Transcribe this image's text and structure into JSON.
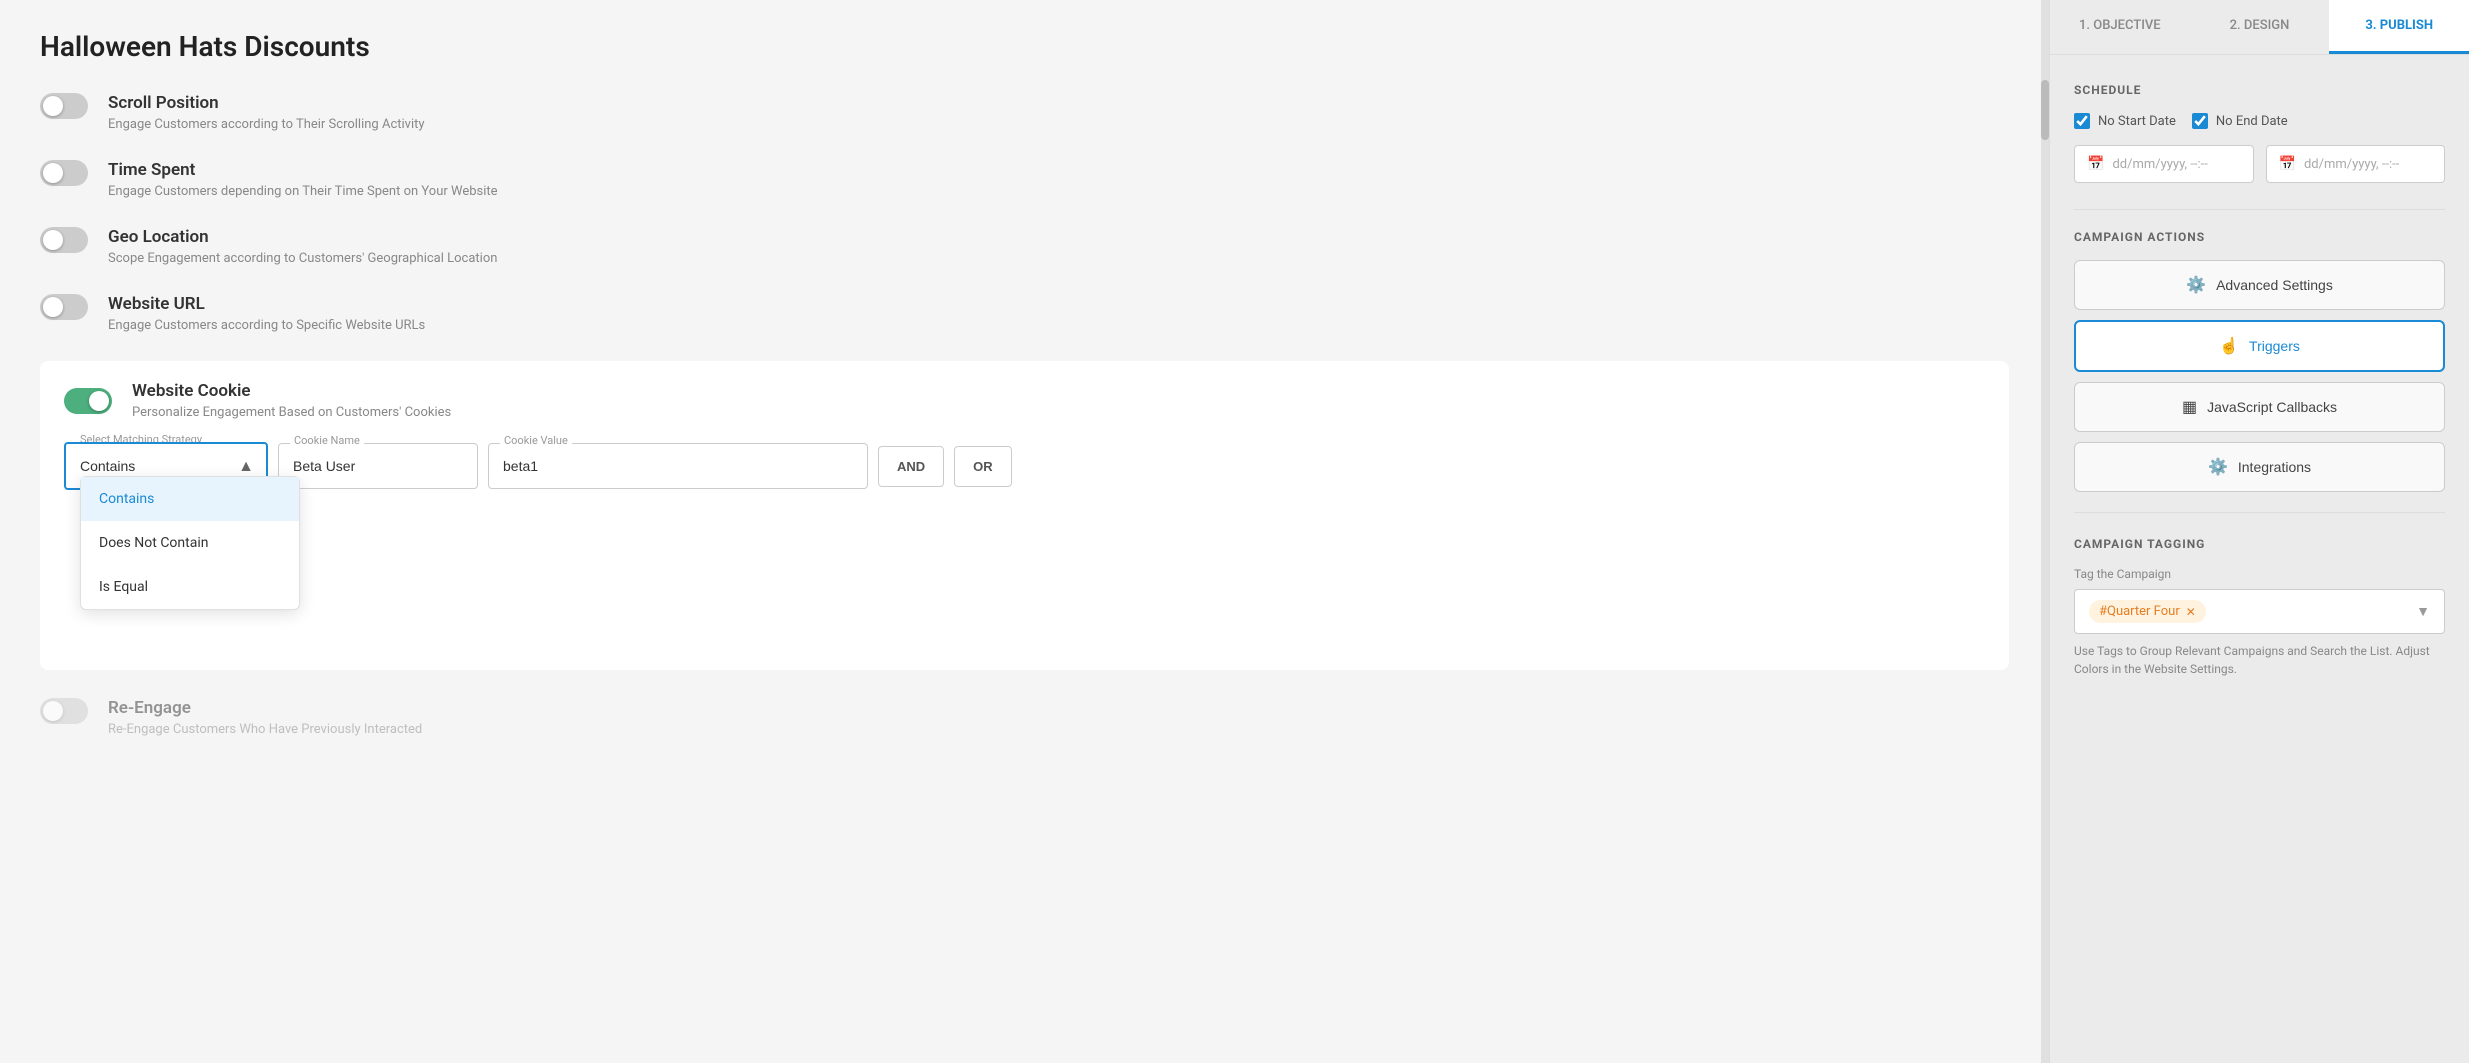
{
  "app": {
    "title": "Halloween Hats Discounts"
  },
  "tabs": [
    {
      "id": "objective",
      "label": "1. OBJECTIVE"
    },
    {
      "id": "design",
      "label": "2. DESIGN"
    },
    {
      "id": "publish",
      "label": "3. PUBLISH",
      "active": true
    }
  ],
  "settings": [
    {
      "id": "scroll-position",
      "title": "Scroll Position",
      "desc": "Engage Customers according to Their Scrolling Activity",
      "enabled": false
    },
    {
      "id": "time-spent",
      "title": "Time Spent",
      "desc": "Engage Customers depending on Their Time Spent on Your Website",
      "enabled": false
    },
    {
      "id": "geo-location",
      "title": "Geo Location",
      "desc": "Scope Engagement according to Customers' Geographical Location",
      "enabled": false
    },
    {
      "id": "website-url",
      "title": "Website URL",
      "desc": "Engage Customers according to Specific Website URLs",
      "enabled": false
    }
  ],
  "cookieSetting": {
    "id": "website-cookie",
    "title": "Website Cookie",
    "desc": "Personalize Engagement Based on Customers' Cookies",
    "enabled": true,
    "selectLabel": "Select Matching Strategy",
    "selectedValue": "Contains",
    "cookieNameLabel": "Cookie Name",
    "cookieNameValue": "Beta User",
    "cookieValueLabel": "Cookie Value",
    "cookieValueValue": "beta1",
    "andBtn": "AND",
    "orBtn": "OR",
    "dropdown": {
      "items": [
        {
          "id": "contains",
          "label": "Contains",
          "selected": true
        },
        {
          "id": "does-not-contain",
          "label": "Does Not Contain",
          "selected": false
        },
        {
          "id": "is-equal",
          "label": "Is Equal",
          "selected": false
        }
      ]
    }
  },
  "fadedSettings": [
    {
      "id": "re-engage",
      "title": "Re-Engage",
      "desc": "Re-Engage Customers Who Have Previously Interacted",
      "enabled": false
    }
  ],
  "rightPanel": {
    "schedule": {
      "sectionTitle": "SCHEDULE",
      "noStartDate": {
        "label": "No Start Date",
        "checked": true
      },
      "noEndDate": {
        "label": "No End Date",
        "checked": true
      },
      "startPlaceholder": "dd/mm/yyyy, --:--",
      "endPlaceholder": "dd/mm/yyyy, --:--"
    },
    "campaignActions": {
      "sectionTitle": "CAMPAIGN ACTIONS",
      "buttons": [
        {
          "id": "advanced-settings",
          "label": "Advanced Settings",
          "icon": "⚙",
          "active": false
        },
        {
          "id": "triggers",
          "label": "Triggers",
          "icon": "👆",
          "active": true
        },
        {
          "id": "javascript-callbacks",
          "label": "JavaScript Callbacks",
          "icon": "⬛",
          "active": false
        },
        {
          "id": "integrations",
          "label": "Integrations",
          "icon": "⚙",
          "active": false
        }
      ]
    },
    "campaignTagging": {
      "sectionTitle": "CAMPAIGN TAGGING",
      "tagLabel": "Tag the Campaign",
      "tags": [
        {
          "id": "quarter-four",
          "label": "#Quarter Four"
        }
      ],
      "helpText": "Use Tags to Group Relevant Campaigns and Search the List. Adjust Colors in the Website Settings."
    }
  }
}
